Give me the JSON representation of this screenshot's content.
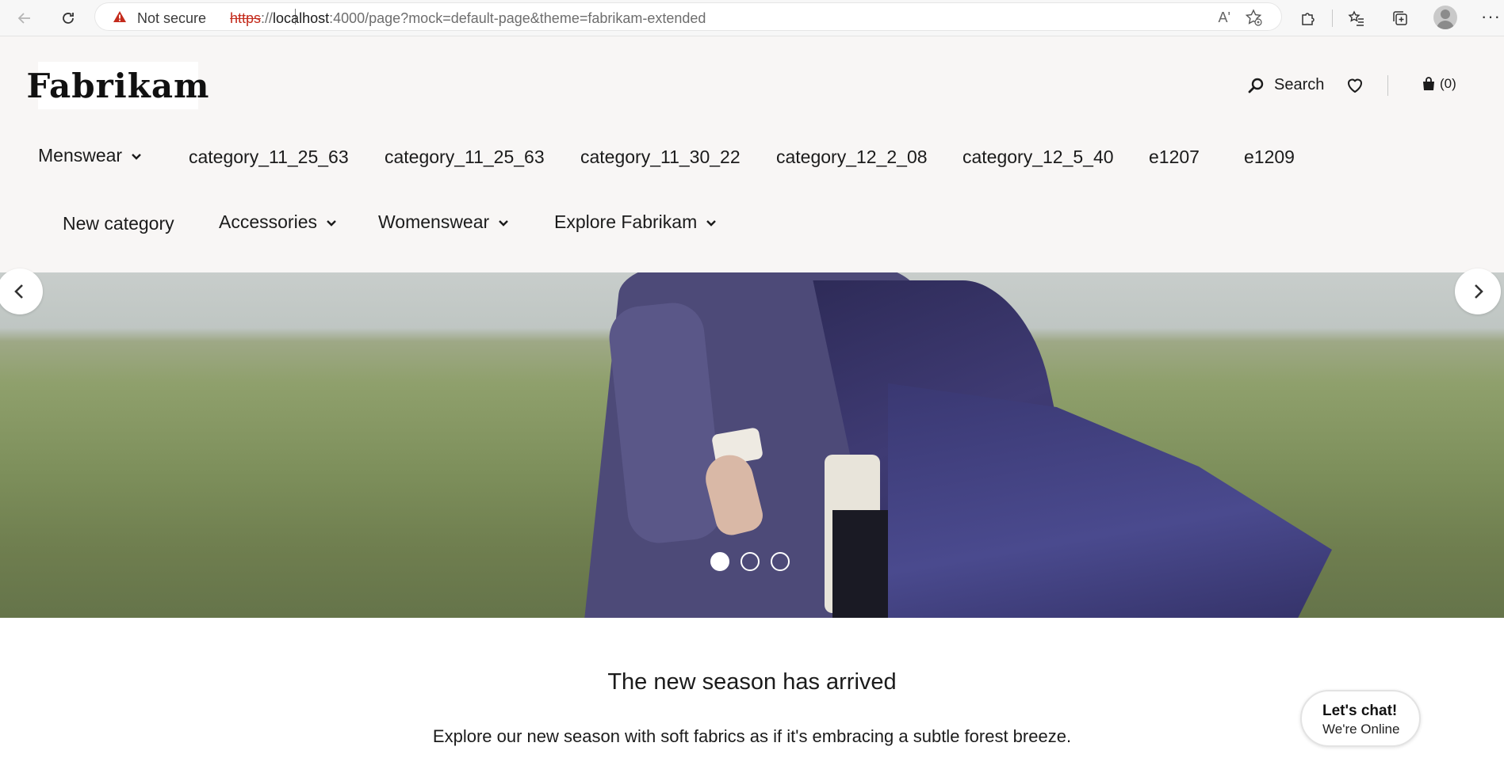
{
  "browser": {
    "not_secure_label": "Not secure",
    "url_protocol": "https",
    "url_separator": "://",
    "url_host": "localhost",
    "url_rest": ":4000/page?mock=default-page&theme=fabrikam-extended",
    "read_aloud_label": "Aʹ",
    "more_label": "···"
  },
  "header": {
    "logo_text": "Fabrikam",
    "search_label": "Search",
    "cart_count_label": "(0)"
  },
  "nav": {
    "row1": [
      {
        "label": "Menswear",
        "has_dropdown": true
      },
      {
        "label": "category_11_25_63",
        "has_dropdown": false
      },
      {
        "label": "category_11_25_63",
        "has_dropdown": false
      },
      {
        "label": "category_11_30_22",
        "has_dropdown": false
      },
      {
        "label": "category_12_2_08",
        "has_dropdown": false
      },
      {
        "label": "category_12_5_40",
        "has_dropdown": false
      },
      {
        "label": "e1207",
        "has_dropdown": false
      },
      {
        "label": "e1209",
        "has_dropdown": false
      }
    ],
    "row2": [
      {
        "label": "New category",
        "has_dropdown": false
      },
      {
        "label": "Accessories",
        "has_dropdown": true
      },
      {
        "label": "Womenswear",
        "has_dropdown": true
      },
      {
        "label": "Explore Fabrikam",
        "has_dropdown": true
      }
    ]
  },
  "hero": {
    "slide_count": 3,
    "active_slide": 1
  },
  "content": {
    "headline": "The new season has arrived",
    "subtext": "Explore our new season with soft fabrics as if it's embracing a subtle forest breeze."
  },
  "chat": {
    "title": "Let's chat!",
    "status": "We're Online"
  },
  "colors": {
    "header_bg": "#f8f6f5",
    "warning_red": "#c42b1c",
    "text": "#1b1b1b"
  }
}
